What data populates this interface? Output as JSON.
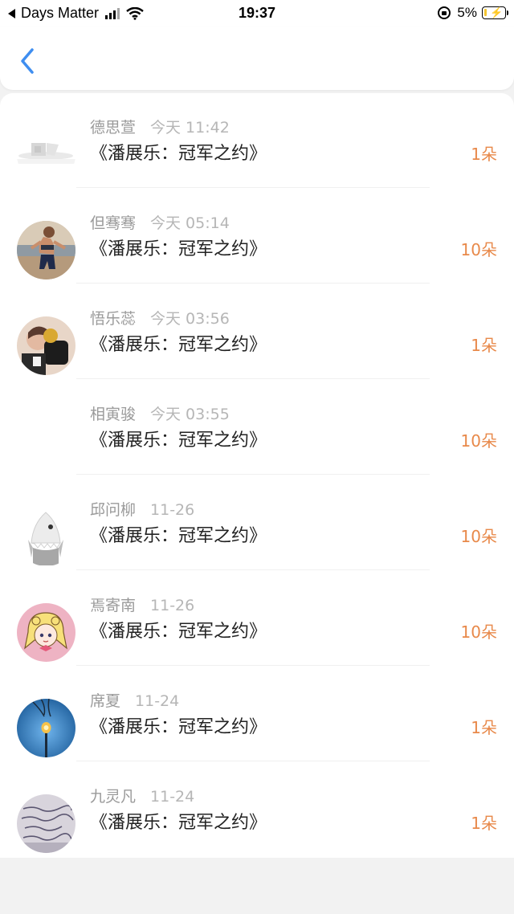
{
  "status_bar": {
    "back_app": "Days Matter",
    "time": "19:37",
    "battery": "5%"
  },
  "nav": {
    "back_icon": "chevron-left-icon",
    "accent": "#3f8ef0"
  },
  "accent_count_color": "#e8894a",
  "records": [
    {
      "name": "德思萱",
      "time": "今天 11:42",
      "title": "《潘展乐：冠军之约》",
      "count": "1朵",
      "avatar": "blank-landscape"
    },
    {
      "name": "但骞骞",
      "time": "今天 05:14",
      "title": "《潘展乐：冠军之约》",
      "count": "10朵",
      "avatar": "runner-photo"
    },
    {
      "name": "悟乐蕊",
      "time": "今天 03:56",
      "title": "《潘展乐：冠军之约》",
      "count": "1朵",
      "avatar": "dark-photo"
    },
    {
      "name": "相寅骏",
      "time": "今天 03:55",
      "title": "《潘展乐：冠军之约》",
      "count": "10朵",
      "avatar": "none"
    },
    {
      "name": "邱问柳",
      "time": "11-26",
      "title": "《潘展乐：冠军之约》",
      "count": "10朵",
      "avatar": "shark-cartoon"
    },
    {
      "name": "焉寄南",
      "time": "11-26",
      "title": "《潘展乐：冠军之约》",
      "count": "10朵",
      "avatar": "anime-girl"
    },
    {
      "name": "席夏",
      "time": "11-24",
      "title": "《潘展乐：冠军之约》",
      "count": "1朵",
      "avatar": "street-lamp"
    },
    {
      "name": "九灵凡",
      "time": "11-24",
      "title": "《潘展乐：冠军之约》",
      "count": "1朵",
      "avatar": "handwriting-photo"
    }
  ]
}
